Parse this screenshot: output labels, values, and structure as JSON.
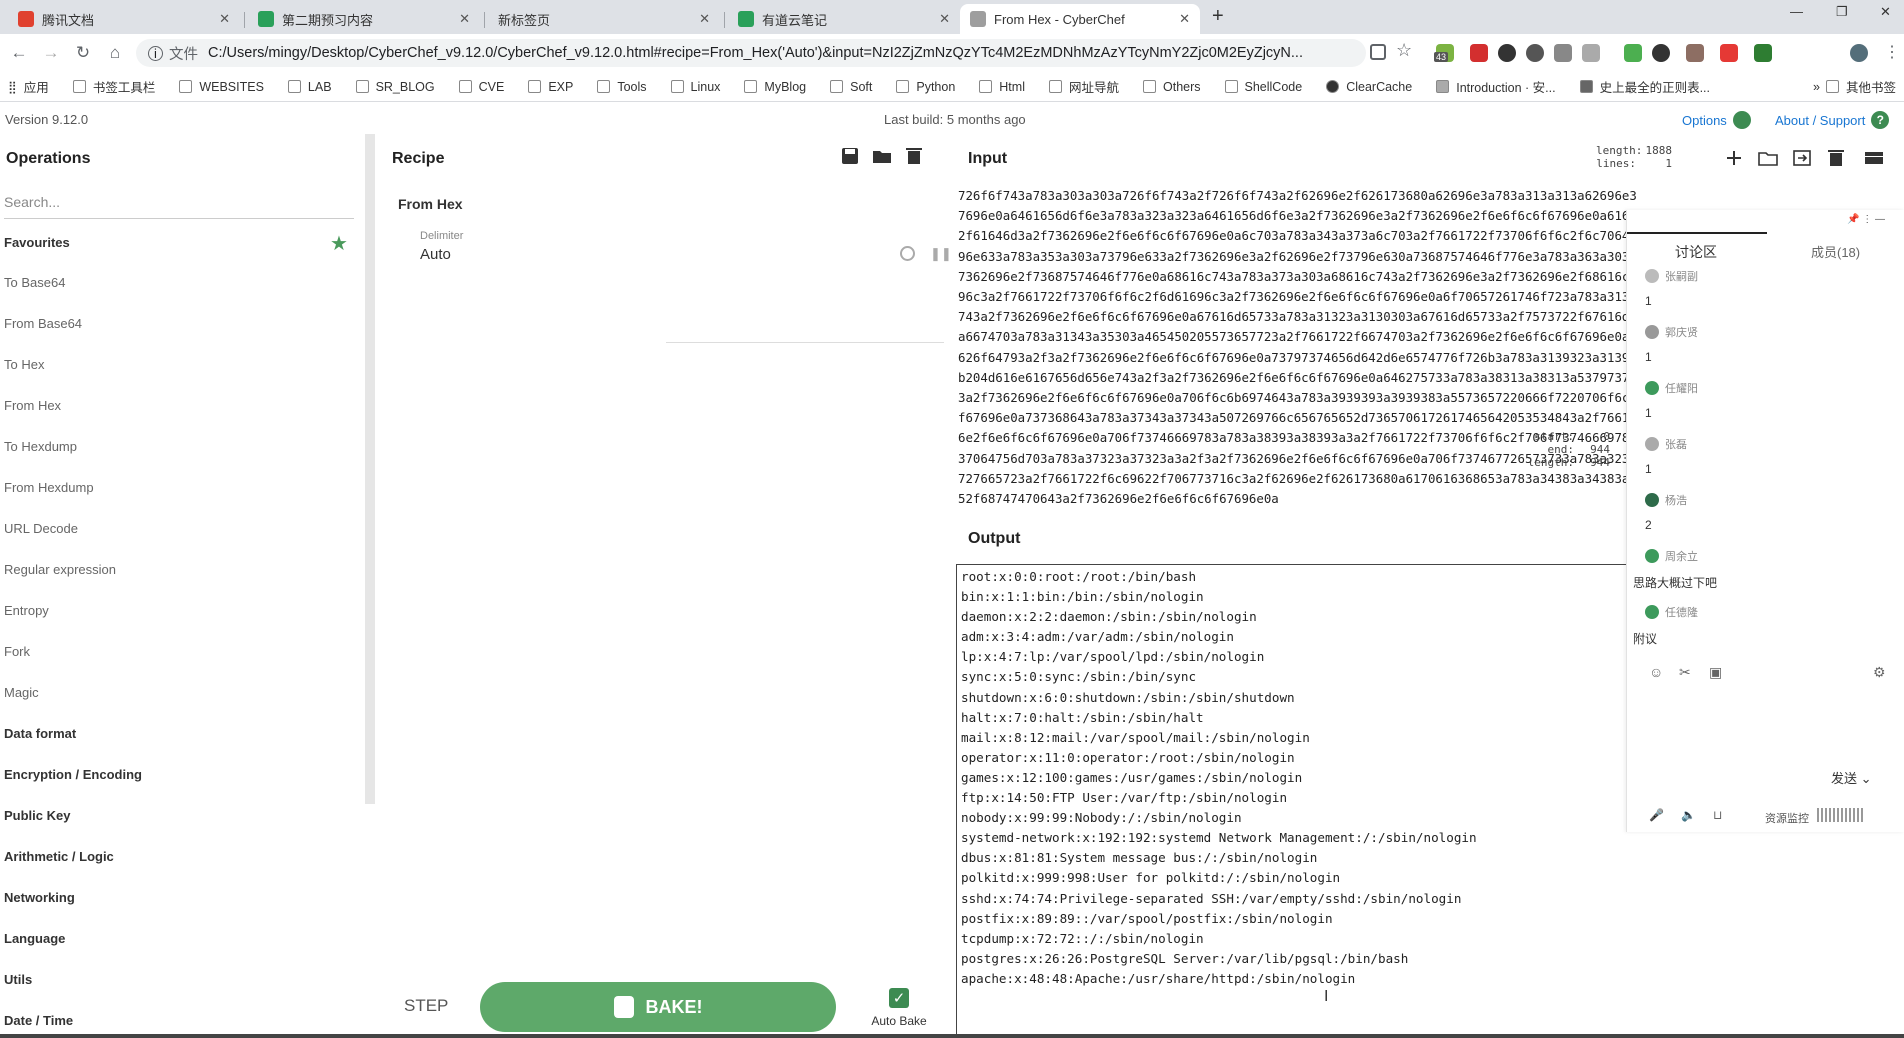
{
  "browser": {
    "tabs": [
      {
        "label": "腾讯文档",
        "icon_color": "#e0412f",
        "icon": "doc-icon"
      },
      {
        "label": "第二期预习内容",
        "icon_color": "#2aa05a",
        "icon": "sheet-icon"
      },
      {
        "label": "新标签页",
        "icon_color": "#dee1e6",
        "icon": "blank-icon"
      },
      {
        "label": "有道云笔记",
        "icon_color": "#2aa05a",
        "icon": "note-icon"
      },
      {
        "label": "From Hex - CyberChef",
        "icon_color": "#9e9e9e",
        "icon": "chef-icon",
        "active": true
      }
    ],
    "new_tab": "+",
    "address": {
      "label": "文件",
      "url": "C:/Users/mingy/Desktop/CyberChef_v9.12.0/CyberChef_v9.12.0.html#recipe=From_Hex('Auto')&input=NzI2ZjZmNzQzYTc4M2EzMDNhMzAzYTcyNmY2Zjc0M2EyZjcyN..."
    },
    "extension_badge": "43",
    "bookmarks": [
      "应用",
      "书签工具栏",
      "WEBSITES",
      "LAB",
      "SR_BLOG",
      "CVE",
      "EXP",
      "Tools",
      "Linux",
      "MyBlog",
      "Soft",
      "Python",
      "Html",
      "网址导航",
      "Others",
      "ShellCode",
      "ClearCache",
      "Introduction · 安...",
      "史上最全的正则表..."
    ],
    "other_bookmarks": "其他书签"
  },
  "app": {
    "version": "Version 9.12.0",
    "last_build": "Last build: 5 months ago",
    "options": "Options",
    "about": "About / Support",
    "accent": "#3d8b52"
  },
  "operations": {
    "title": "Operations",
    "search_placeholder": "Search...",
    "favourites": "Favourites",
    "items": [
      "To Base64",
      "From Base64",
      "To Hex",
      "From Hex",
      "To Hexdump",
      "From Hexdump",
      "URL Decode",
      "Regular expression",
      "Entropy",
      "Fork",
      "Magic"
    ],
    "categories": [
      "Data format",
      "Encryption / Encoding",
      "Public Key",
      "Arithmetic / Logic",
      "Networking",
      "Language",
      "Utils",
      "Date / Time"
    ]
  },
  "recipe": {
    "title": "Recipe",
    "operation": "From Hex",
    "delimiter_label": "Delimiter",
    "delimiter_value": "Auto",
    "step_label": "STEP",
    "bake_label": "BAKE!",
    "autobake_label": "Auto Bake",
    "autobake_checked": true
  },
  "input": {
    "title": "Input",
    "length_label": "length:",
    "length_value": "1888",
    "lines_label": "lines:",
    "lines_value": "1",
    "lines": [
      "726f6f743a783a303a303a726f6f743a2f726f6f743a2f62696e2f626173680a62696e3a783a313a313a62696e3a2f62696e3a2f7362696e2f6e6f6c6f6",
      "7696e0a6461656d6f6e3a783a323a323a6461656d6f6e3a2f7362696e3a2f7362696e2f6e6f6c6f67696e0a61646d3a783a333a343a61646d3a2f766",
      "2f61646d3a2f7362696e2f6e6f6c6f67696e0a6c703a783a343a373a6c703a2f7661722f73706f6f6c2f6c70643a2f7362696e2f6e6f6c6f67696e0a",
      "96e633a783a353a303a73796e633a2f7362696e3a2f62696e2f73796e630a73687574646f776e3a783a363a303a73687574646f776e3a2f7362696e3",
      "7362696e2f73687574646f776e0a68616c743a783a373a303a68616c743a2f7362696e3a2f7362696e2f68616c740a6d61696c3a783a383a31323a6d",
      "96c3a2f7661722f73706f6f6c2f6d61696c3a2f7362696e2f6e6f6c6f67696e0a6f70657261746f723a783a31313a303a6f70657261746f723a2f726f",
      "743a2f7362696e2f6e6f6c6f67696e0a67616d65733a783a31323a3130303a67616d65733a2f7573722f67616d65733a2f7362696e2f6e6f6c6f6769",
      "a6674703a783a31343a35303a465450205573657723a2f7661722f6674703a2f7362696e2f6e6f6c6f67696e0a6e6f626f64793a783a39393a39393a4e6f",
      "626f64793a2f3a2f7362696e2f6e6f6c6f67696e0a73797374656d642d6e6574776f726b3a783a3139323a3139323a73797374656d64204e6574776f72",
      "b204d616e6167656d656e743a2f3a2f7362696e2f6e6f6c6f67696e0a646275733a783a38313a38313a53797374656d206d6573736167652062757",
      "3a2f7362696e2f6e6f6c6f67696e0a706f6c6b6974643a783a3939393a3939383a5573657220666f7220706f6c6b6974643a2f3a2f7362696e2f6e6f6c",
      "f67696e0a737368643a783a37343a37343a507269766c656765652d7365706172617465642053534843a2f7661722f656d7074792f737368643a2f7362696e",
      "6e2f6e6f6c6f67696e0a706f73746669783a783a38393a38393a3a2f7661722f73706f6f6c2f706f73746669783a2f7362696e2f6e6f6c6f67696e0a7463",
      "37064756d703a783a37323a37323a3a2f3a2f7362696e2f6e6f6c6f67696e0a706f737467726573733a783a32363a32363a506f737467726553514c205365",
      "727665723a2f7661722f6c69622f706773716c3a2f62696e2f626173680a6170616368653a783a34383a34383a4170616368653a2f7573722f7368617265",
      "52f68747470643a2f7362696e2f6e6f6c6f67696e0a"
    ]
  },
  "output": {
    "title": "Output",
    "start_label": "start:",
    "start_value": "0",
    "end_label": "end:",
    "end_value": "944",
    "length_label": "length:",
    "length_value": "944",
    "lines": [
      "root:x:0:0:root:/root:/bin/bash",
      "bin:x:1:1:bin:/bin:/sbin/nologin",
      "daemon:x:2:2:daemon:/sbin:/sbin/nologin",
      "adm:x:3:4:adm:/var/adm:/sbin/nologin",
      "lp:x:4:7:lp:/var/spool/lpd:/sbin/nologin",
      "sync:x:5:0:sync:/sbin:/bin/sync",
      "shutdown:x:6:0:shutdown:/sbin:/sbin/shutdown",
      "halt:x:7:0:halt:/sbin:/sbin/halt",
      "mail:x:8:12:mail:/var/spool/mail:/sbin/nologin",
      "operator:x:11:0:operator:/root:/sbin/nologin",
      "games:x:12:100:games:/usr/games:/sbin/nologin",
      "ftp:x:14:50:FTP User:/var/ftp:/sbin/nologin",
      "nobody:x:99:99:Nobody:/:/sbin/nologin",
      "systemd-network:x:192:192:systemd Network Management:/:/sbin/nologin",
      "dbus:x:81:81:System message bus:/:/sbin/nologin",
      "polkitd:x:999:998:User for polkitd:/:/sbin/nologin",
      "sshd:x:74:74:Privilege-separated SSH:/var/empty/sshd:/sbin/nologin",
      "postfix:x:89:89::/var/spool/postfix:/sbin/nologin",
      "tcpdump:x:72:72::/:/sbin/nologin",
      "postgres:x:26:26:PostgreSQL Server:/var/lib/pgsql:/bin/bash",
      "apache:x:48:48:Apache:/usr/share/httpd:/sbin/nologin"
    ]
  },
  "chat": {
    "tab_discussion": "讨论区",
    "tab_members": "成员(18)",
    "messages": [
      {
        "user": "张嗣副",
        "text": "1",
        "avatar_color": "#bbbbbb"
      },
      {
        "user": "郭庆贤",
        "text": "1",
        "avatar_color": "#999999"
      },
      {
        "user": "任耀阳",
        "text": "1",
        "avatar_color": "#3d9a5c"
      },
      {
        "user": "张磊",
        "text": "1",
        "avatar_color": "#aaaaaa"
      },
      {
        "user": "杨浩",
        "text": "2",
        "avatar_color": "#2e6b4a"
      },
      {
        "user": "周余立",
        "text": "思路大概过下吧",
        "avatar_color": "#3d9a5c"
      },
      {
        "user": "任德隆",
        "text": "附议",
        "avatar_color": "#3d9a5c"
      }
    ],
    "send_label": "发送",
    "resource_label": "资源监控"
  }
}
